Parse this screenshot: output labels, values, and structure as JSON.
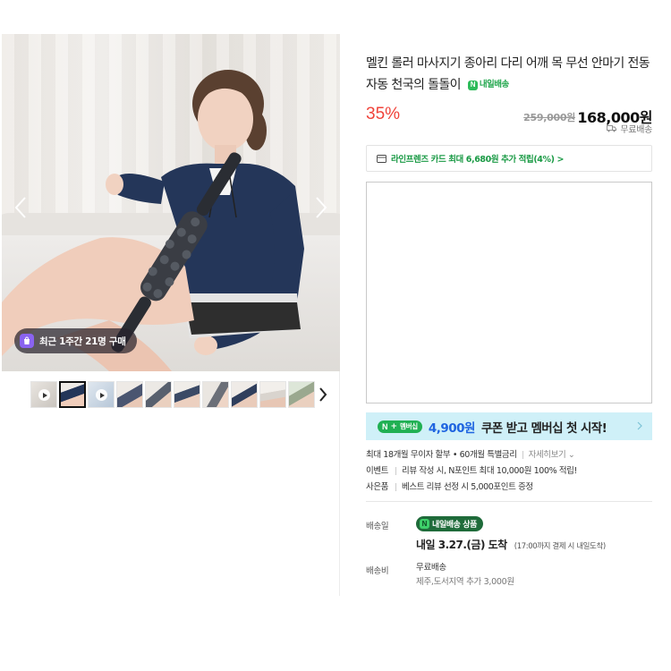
{
  "gallery": {
    "recent_purchase": "최근 1주간 21명 구매",
    "thumbnail_count": 10,
    "active_thumbnail": 2
  },
  "product": {
    "title": "멜킨 롤러 마사지기 종아리 다리 어깨 목 무선 안마기 전동 자동 천국의 돌돌이",
    "delivery_tag": "내일배송",
    "discount": "35%",
    "original_price": "259,000원",
    "sale_price": "168,000원",
    "shipping": "무료배송"
  },
  "card_benefit": {
    "text": "라인프렌즈 카드 최대 6,680원 추가 적립(4%) >"
  },
  "membership": {
    "badge_n": "N",
    "badge_plus": "+",
    "badge_text": "멤버십",
    "amount": "4,900원",
    "rest": "쿠폰 받고 멤버십 첫 시작!"
  },
  "benefits": {
    "installment": "최대 18개월 무이자 할부 • 60개월 특별금리",
    "installment_more": "자세히보기 ⌄",
    "event_label": "이벤트",
    "event_text": "리뷰 작성 시, N포인트 최대 10,000원 100% 적립!",
    "gift_label": "사은품",
    "gift_text": "베스트 리뷰 선정 시 5,000포인트 증정"
  },
  "delivery": {
    "label": "배송일",
    "pill": "내일배송 상품",
    "arrival": "내일 3.27.(금) 도착",
    "arrival_note": "(17:00까지 결제 시 내일도착)"
  },
  "shipping_fee": {
    "label": "배송비",
    "value": "무료배송",
    "extra": "제주,도서지역 추가 3,000원"
  },
  "colors": {
    "discount": "#f0433a",
    "green": "#2dbb5a",
    "membership_bg": "#cff0f8",
    "membership_amount": "#1f64e0"
  }
}
